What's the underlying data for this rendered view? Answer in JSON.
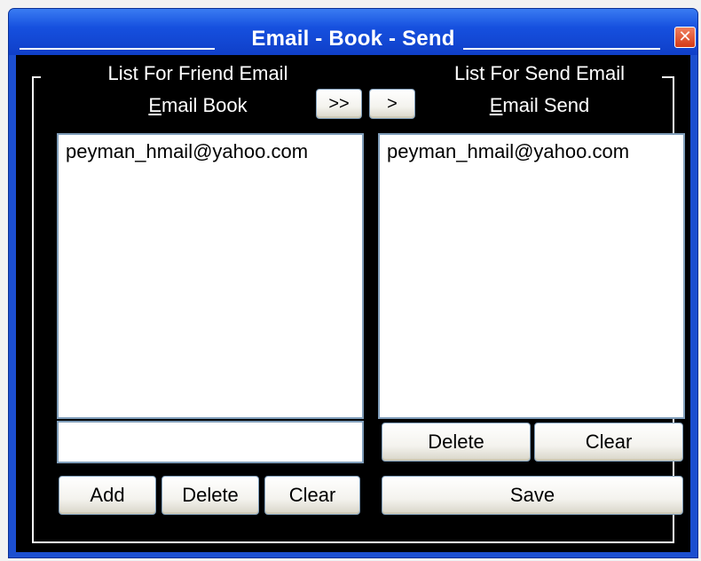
{
  "window": {
    "title": "Email - Book - Send",
    "close_glyph": "✕"
  },
  "left_panel": {
    "caption": "List For Friend Email",
    "label_mnemonic": "E",
    "label_rest": "mail Book",
    "items": [
      "peyman_hmail@yahoo.com"
    ],
    "input_value": "",
    "buttons": {
      "add": "Add",
      "delete": "Delete",
      "clear": "Clear"
    }
  },
  "transfer": {
    "move_all_label": ">>",
    "move_one_label": ">"
  },
  "right_panel": {
    "caption": "List For Send Email",
    "label_mnemonic": "E",
    "label_rest": "mail Send",
    "items": [
      "peyman_hmail@yahoo.com"
    ],
    "buttons": {
      "delete": "Delete",
      "clear": "Clear",
      "save": "Save"
    }
  }
}
